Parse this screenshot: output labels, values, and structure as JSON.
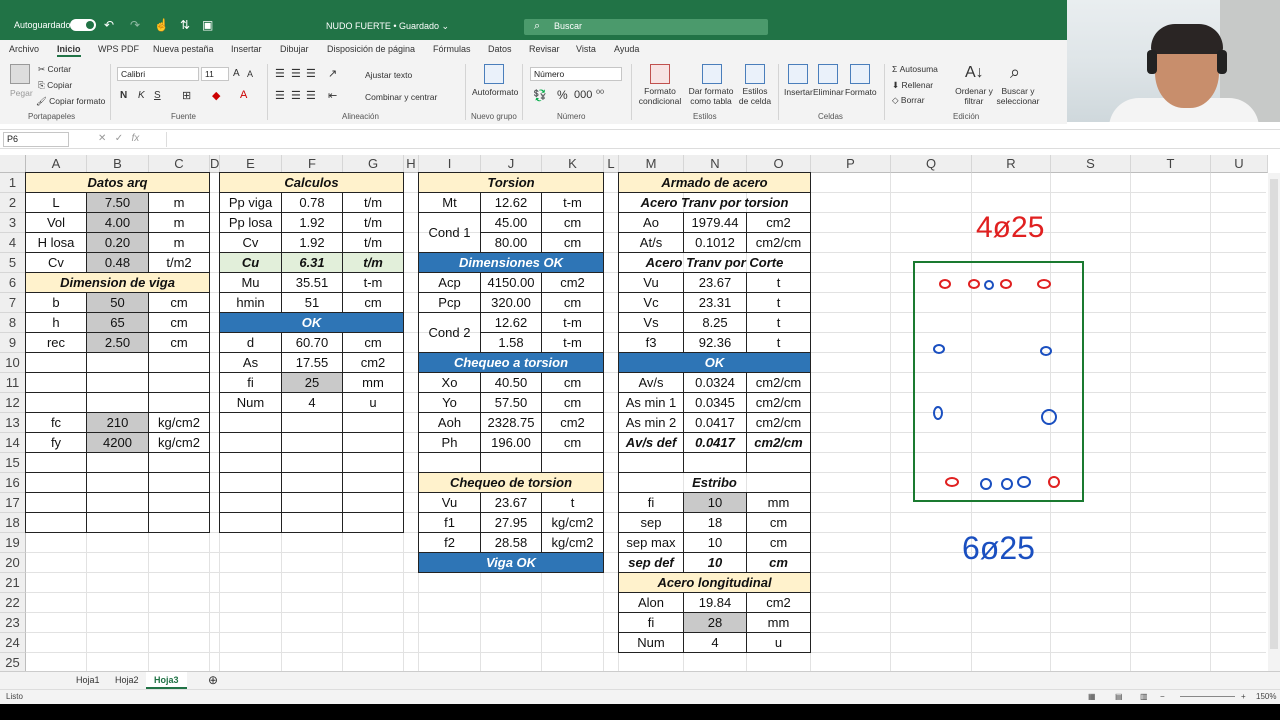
{
  "titlebar": {
    "autosave_label": "Autoguardado",
    "doc_title": "NUDO FUERTE • Guardado ⌄",
    "search_placeholder": "Buscar"
  },
  "menu": [
    "Archivo",
    "Inicio",
    "WPS PDF",
    "Nueva pestaña",
    "Insertar",
    "Dibujar",
    "Disposición de página",
    "Fórmulas",
    "Datos",
    "Revisar",
    "Vista",
    "Ayuda"
  ],
  "ribbon": {
    "clipboard": {
      "paste": "Pegar",
      "cut": "Cortar",
      "copy": "Copiar",
      "format_painter": "Copiar formato",
      "group": "Portapapeles"
    },
    "font": {
      "name": "Calibri",
      "size": "11",
      "group": "Fuente",
      "bold": "N",
      "italic": "K",
      "underline": "S"
    },
    "alignment": {
      "wrap": "Ajustar texto",
      "merge": "Combinar y centrar",
      "group": "Alineación"
    },
    "new_group": {
      "autoformat": "Autoformato",
      "group": "Nuevo grupo"
    },
    "number": {
      "format": "Número",
      "group": "Número"
    },
    "styles": {
      "conditional": "Formato condicional",
      "as_table": "Dar formato como tabla",
      "cell_styles": "Estilos de celda",
      "group": "Estilos"
    },
    "cells": {
      "insert": "Insertar",
      "delete": "Eliminar",
      "format": "Formato",
      "group": "Celdas"
    },
    "editing": {
      "autosum": "Autosuma",
      "fill": "Rellenar",
      "clear": "Borrar",
      "sort": "Ordenar y filtrar",
      "find": "Buscar y seleccionar",
      "group": "Edición"
    }
  },
  "formula_bar": {
    "name_box": "P6",
    "formula": ""
  },
  "columns": [
    "A",
    "B",
    "C",
    "D",
    "E",
    "F",
    "G",
    "H",
    "I",
    "J",
    "K",
    "L",
    "M",
    "N",
    "O",
    "P",
    "Q",
    "R",
    "S",
    "T",
    "U"
  ],
  "rows": [
    "1",
    "2",
    "3",
    "4",
    "5",
    "6",
    "7",
    "8",
    "9",
    "10",
    "11",
    "12",
    "13",
    "14",
    "15",
    "16",
    "17",
    "18",
    "19",
    "20",
    "21",
    "22",
    "23",
    "24",
    "25"
  ],
  "datos_arq": {
    "title": "Datos arq",
    "rows": [
      [
        "L",
        "7.50",
        "m"
      ],
      [
        "Vol",
        "4.00",
        "m"
      ],
      [
        "H losa",
        "0.20",
        "m"
      ],
      [
        "Cv",
        "0.48",
        "t/m2"
      ]
    ]
  },
  "dimension_viga": {
    "title": "Dimension de viga",
    "rows": [
      [
        "b",
        "50",
        "cm"
      ],
      [
        "h",
        "65",
        "cm"
      ],
      [
        "rec",
        "2.50",
        "cm"
      ]
    ],
    "materials": [
      [
        "fc",
        "210",
        "kg/cm2"
      ],
      [
        "fy",
        "4200",
        "kg/cm2"
      ]
    ]
  },
  "calculos": {
    "title": "Calculos",
    "rows": [
      [
        "Pp viga",
        "0.78",
        "t/m"
      ],
      [
        "Pp losa",
        "1.92",
        "t/m"
      ],
      [
        "Cv",
        "1.92",
        "t/m"
      ],
      [
        "Cu",
        "6.31",
        "t/m"
      ],
      [
        "Mu",
        "35.51",
        "t-m"
      ],
      [
        "hmin",
        "51",
        "cm"
      ]
    ],
    "ok": "OK",
    "rows2": [
      [
        "d",
        "60.70",
        "cm"
      ],
      [
        "As",
        "17.55",
        "cm2"
      ],
      [
        "fi",
        "25",
        "mm"
      ],
      [
        "Num",
        "4",
        "u"
      ]
    ]
  },
  "torsion": {
    "title": "Torsion",
    "mt": [
      "Mt",
      "12.62",
      "t-m"
    ],
    "cond1": {
      "label": "Cond 1",
      "rows": [
        [
          "45.00",
          "cm"
        ],
        [
          "80.00",
          "cm"
        ]
      ]
    },
    "dim_ok": "Dimensiones OK",
    "rows": [
      [
        "Acp",
        "4150.00",
        "cm2"
      ],
      [
        "Pcp",
        "320.00",
        "cm"
      ]
    ],
    "cond2": {
      "label": "Cond 2",
      "rows": [
        [
          "12.62",
          "t-m"
        ],
        [
          "1.58",
          "t-m"
        ]
      ]
    },
    "chequeo_title": "Chequeo a torsion",
    "rows2": [
      [
        "Xo",
        "40.50",
        "cm"
      ],
      [
        "Yo",
        "57.50",
        "cm"
      ],
      [
        "Aoh",
        "2328.75",
        "cm2"
      ],
      [
        "Ph",
        "196.00",
        "cm"
      ]
    ],
    "chequeo2_title": "Chequeo de torsion",
    "rows3": [
      [
        "Vu",
        "23.67",
        "t"
      ],
      [
        "f1",
        "27.95",
        "kg/cm2"
      ],
      [
        "f2",
        "28.58",
        "kg/cm2"
      ]
    ],
    "viga_ok": "Viga OK"
  },
  "armado": {
    "title": "Armado de acero",
    "tranv_torsion": "Acero Tranv por torsion",
    "rows1": [
      [
        "Ao",
        "1979.44",
        "cm2"
      ],
      [
        "At/s",
        "0.1012",
        "cm2/cm"
      ]
    ],
    "tranv_corte": "Acero Tranv por Corte",
    "rows2": [
      [
        "Vu",
        "23.67",
        "t"
      ],
      [
        "Vc",
        "23.31",
        "t"
      ],
      [
        "Vs",
        "8.25",
        "t"
      ],
      [
        "f3",
        "92.36",
        "t"
      ]
    ],
    "ok": "OK",
    "rows3": [
      [
        "Av/s",
        "0.0324",
        "cm2/cm"
      ],
      [
        "As min 1",
        "0.0345",
        "cm2/cm"
      ],
      [
        "As min 2",
        "0.0417",
        "cm2/cm"
      ],
      [
        "Av/s def",
        "0.0417",
        "cm2/cm"
      ]
    ],
    "estribo": "Estribo",
    "rows4": [
      [
        "fi",
        "10",
        "mm"
      ],
      [
        "sep",
        "18",
        "cm"
      ],
      [
        "sep max",
        "10",
        "cm"
      ],
      [
        "sep def",
        "10",
        "cm"
      ]
    ],
    "longitudinal": "Acero longitudinal",
    "rows5": [
      [
        "Alon",
        "19.84",
        "cm2"
      ],
      [
        "fi",
        "28",
        "mm"
      ],
      [
        "Num",
        "4",
        "u"
      ]
    ]
  },
  "sketch": {
    "top_label": "4ø25",
    "bottom_label": "6ø25"
  },
  "sheets": [
    "Hoja1",
    "Hoja2",
    "Hoja3"
  ],
  "active_sheet": "Hoja3",
  "status": {
    "ready": "Listo",
    "zoom": "150%"
  }
}
